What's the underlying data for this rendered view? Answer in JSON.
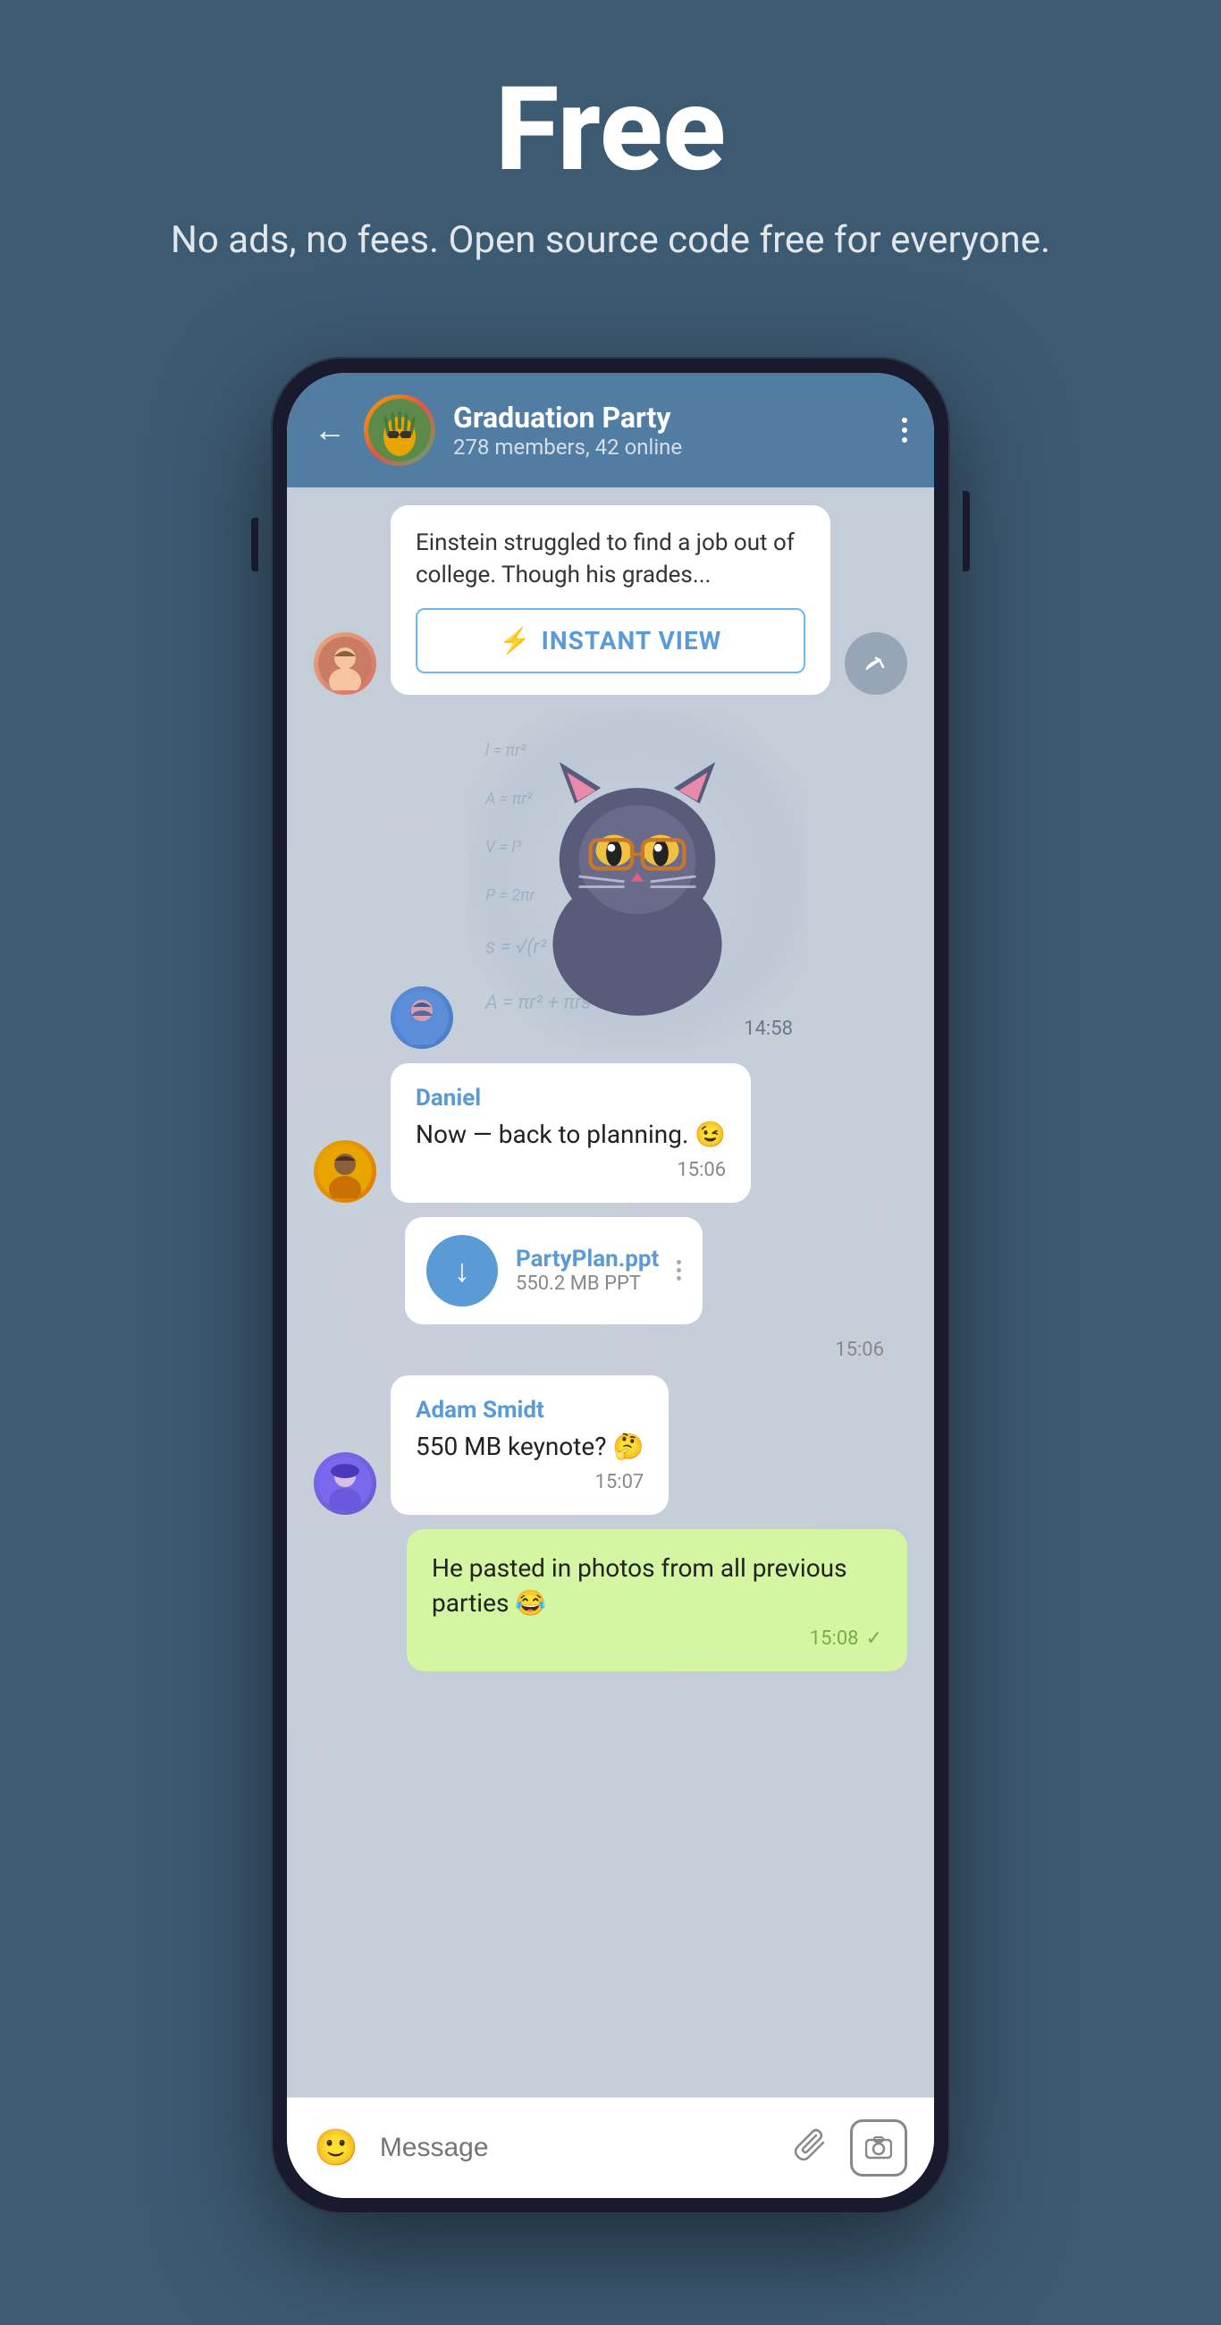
{
  "hero": {
    "title": "Free",
    "subtitle": "No ads, no fees. Open source code free for everyone."
  },
  "header": {
    "back_label": "←",
    "group_name": "Graduation Party",
    "group_meta": "278 members, 42 online",
    "more_icon": "⋮",
    "avatar_emoji": "🍍"
  },
  "messages": [
    {
      "id": "link-preview",
      "type": "link",
      "text": "Einstein struggled to find a job out of college. Though his grades...",
      "instant_view_label": "INSTANT VIEW"
    },
    {
      "id": "sticker",
      "type": "sticker",
      "time": "14:58"
    },
    {
      "id": "daniel-msg",
      "sender": "Daniel",
      "text": "Now — back to planning. 😉",
      "time": "15:06"
    },
    {
      "id": "file-msg",
      "type": "file",
      "file_name": "PartyPlan.ppt",
      "file_size": "550.2 MB PPT",
      "time": "15:06"
    },
    {
      "id": "adam-msg",
      "sender": "Adam Smidt",
      "text": "550 MB keynote? 🤔",
      "time": "15:07"
    },
    {
      "id": "sent-msg",
      "type": "sent",
      "text": "He pasted in photos from all previous parties 😂",
      "time": "15:08"
    }
  ],
  "input": {
    "placeholder": "Message",
    "emoji_icon": "😊",
    "attach_icon": "📎",
    "camera_icon": "📷"
  },
  "colors": {
    "background": "#3d5a73",
    "header": "#527da3",
    "chat_bg": "#c5cdd8",
    "bubble_white": "#ffffff",
    "bubble_sent": "#d4f5a2",
    "accent_blue": "#5b9bd5",
    "sender_color": "#5b9bd5"
  }
}
